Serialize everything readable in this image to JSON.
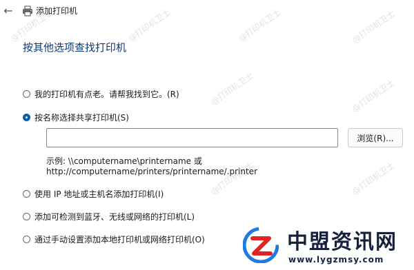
{
  "window": {
    "title": "添加打印机",
    "back_icon": "arrow-left-icon",
    "app_icon": "printer-icon"
  },
  "page": {
    "heading": "按其他选项查找打印机"
  },
  "options": [
    {
      "label": "我的打印机有点老。请帮我找到它。(R)",
      "selected": false
    },
    {
      "label": "按名称选择共享打印机(S)",
      "selected": true
    },
    {
      "label": "使用 IP 地址或主机名添加打印机(I)",
      "selected": false
    },
    {
      "label": "添加可检测到蓝牙、无线或网络的打印机(L)",
      "selected": false
    },
    {
      "label": "通过手动设置添加本地打印机或网络打印机(O)",
      "selected": false
    }
  ],
  "shared_printer": {
    "value": "",
    "browse_label": "浏览(R)...",
    "example_line1": "示例: \\\\computername\\printername 或",
    "example_line2": "http://computername/printers/printername/.printer"
  },
  "watermarks": [
    "@打印机卫士",
    "@打印机卫士",
    "@打印机卫士",
    "@打印机卫士",
    "@打印机卫士",
    "@打印机卫士",
    "@打印机卫士",
    "@打印机卫士"
  ],
  "brand": {
    "name": "中盟资讯网",
    "url": "www.lygzmsy.com",
    "colors": {
      "blue": "#1e7be0",
      "red": "#e02424",
      "dark": "#16223d"
    }
  }
}
